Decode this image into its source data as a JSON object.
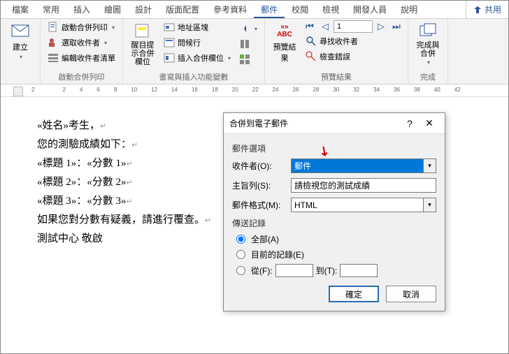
{
  "tabs": {
    "t0": "檔案",
    "t1": "常用",
    "t2": "插入",
    "t3": "繪圖",
    "t4": "設計",
    "t5": "版面配置",
    "t6": "參考資料",
    "t7": "郵件",
    "t8": "校閱",
    "t9": "檢視",
    "t10": "開發人員",
    "t11": "說明",
    "share": "共用"
  },
  "ribbon": {
    "g1": {
      "btn": "建立",
      "label": ""
    },
    "g2": {
      "b1": "啟動合併列印",
      "b2": "選取收件者",
      "b3": "編輯收件者清單",
      "label": "啟動合併列印"
    },
    "g3": {
      "btn1": "醒目提示合併欄位",
      "label": "書寫與插入功能變數",
      "b1": "地址區塊",
      "b2": "問候行",
      "b3": "插入合併欄位"
    },
    "g4": {
      "btn": "預覽結果",
      "b1": "尋找收件者",
      "b2": "檢查錯誤",
      "nav_value": "1",
      "label": "預覽結果"
    },
    "g5": {
      "btn": "完成與合併",
      "label": "完成"
    }
  },
  "ruler_ticks": [
    "2",
    "",
    "2",
    "4",
    "6",
    "8",
    "10",
    "12",
    "14",
    "16",
    "18",
    "20",
    "22",
    "24",
    "26",
    "28",
    "30",
    "32",
    "34",
    "36",
    "38",
    "40",
    "42"
  ],
  "doc": {
    "l1a": "«姓名»",
    "l1b": "考生，",
    "l2": "您的測驗成績如下：",
    "l3a": "«標題 1»",
    "l3b": "：",
    "l3c": "«分數 1»",
    "l4a": "«標題 2»",
    "l4b": "：",
    "l4c": "«分數 2»",
    "l5a": "«標題 3»",
    "l5b": "：",
    "l5c": "«分數 3»",
    "l6": "如果您對分數有疑義，請進行覆查。",
    "l7": "測試中心 敬啟"
  },
  "dialog": {
    "title": "合併到電子郵件",
    "sec1": "郵件選項",
    "to_label": "收件者(O):",
    "to_value": "郵件",
    "subj_label": "主旨列(S):",
    "subj_value": "請檢視您的測試成績",
    "fmt_label": "郵件格式(M):",
    "fmt_value": "HTML",
    "sec2": "傳送記錄",
    "r1": "全部(A)",
    "r2": "目前的記錄(E)",
    "r3a": "從(F):",
    "r3b": "到(T):",
    "ok": "確定",
    "cancel": "取消"
  }
}
